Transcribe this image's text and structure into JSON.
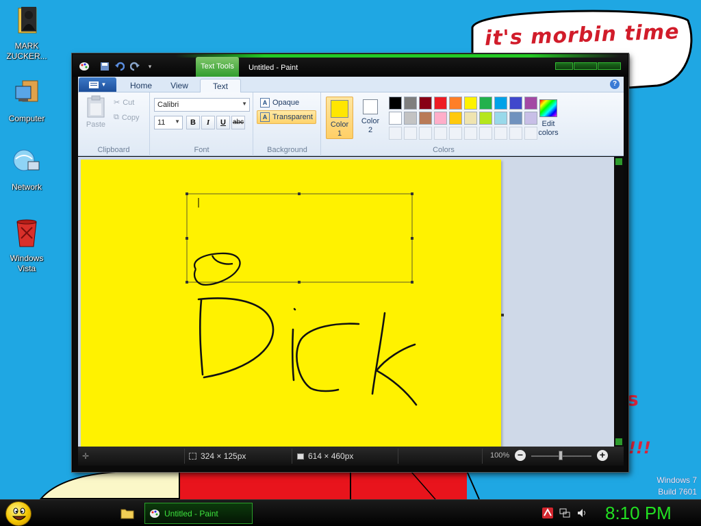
{
  "desktop": {
    "speech_bubble_text": "it's morbin time",
    "side_text_1": "s",
    "side_text_2": "!!!",
    "icons": [
      {
        "label": "MARK ZUCKER..."
      },
      {
        "label": "Computer"
      },
      {
        "label": "Network"
      },
      {
        "label": "Windows Vista"
      }
    ],
    "watermark": {
      "line1": "Windows 7",
      "line2": "Build 7601"
    }
  },
  "window": {
    "contextual_tab": "Text Tools",
    "title": "Untitled - Paint",
    "tabs": [
      {
        "label": "Home"
      },
      {
        "label": "View"
      },
      {
        "label": "Text"
      }
    ],
    "help_label": "?"
  },
  "ribbon": {
    "clipboard": {
      "paste": "Paste",
      "cut": "Cut",
      "copy": "Copy",
      "label": "Clipboard"
    },
    "font": {
      "family": "Calibri",
      "size": "11",
      "bold": "B",
      "italic": "I",
      "underline": "U",
      "strike": "abc",
      "label": "Font"
    },
    "background": {
      "opaque": "Opaque",
      "transparent": "Transparent",
      "label": "Background",
      "icon_letter": "A"
    },
    "colors": {
      "color1_line1": "Color",
      "color1_line2": "1",
      "color1_value": "#ffe600",
      "color2_line1": "Color",
      "color2_line2": "2",
      "color2_value": "#ffffff",
      "edit_line1": "Edit",
      "edit_line2": "colors",
      "label": "Colors",
      "palette_row1": [
        "#000000",
        "#7f7f7f",
        "#880015",
        "#ed1c24",
        "#ff7f27",
        "#fff200",
        "#22b14c",
        "#00a2e8",
        "#3f48cc",
        "#a349a4"
      ],
      "palette_row2": [
        "#ffffff",
        "#c3c3c3",
        "#b97a57",
        "#ffaec9",
        "#ffc90e",
        "#efe4b0",
        "#b5e61d",
        "#99d9ea",
        "#7092be",
        "#c8bfe7"
      ]
    }
  },
  "canvas": {
    "background": "#fff200",
    "drawn_word": "Dick"
  },
  "statusbar": {
    "selection_size": "324 × 125px",
    "canvas_size": "614 × 460px",
    "zoom": "100%",
    "zoom_out": "−",
    "zoom_in": "+"
  },
  "taskbar": {
    "app_label": "Untitled - Paint",
    "clock": "8:10 PM"
  }
}
